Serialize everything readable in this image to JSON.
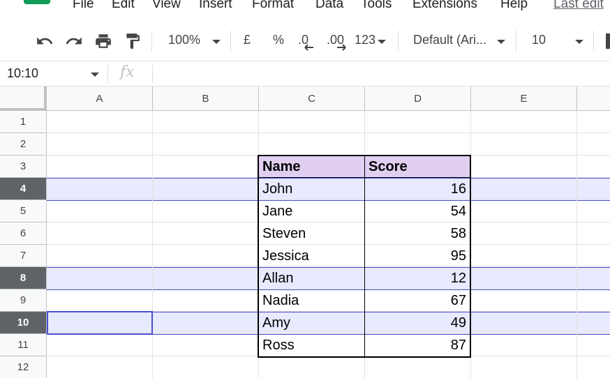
{
  "menu": {
    "items": [
      "File",
      "Edit",
      "View",
      "Insert",
      "Format",
      "Data",
      "Tools",
      "Extensions",
      "Help"
    ],
    "last_edit": "Last edit"
  },
  "toolbar": {
    "zoom": "100%",
    "currency": "£",
    "percent": "%",
    "decrease_decimal": ".0",
    "increase_decimal": ".00",
    "more_formats": "123",
    "font": "Default (Ari...",
    "font_size": "10"
  },
  "formula_bar": {
    "name_box": "10:10",
    "fx": "fx"
  },
  "grid": {
    "columns": [
      "A",
      "B",
      "C",
      "D",
      "E"
    ],
    "rows": [
      "1",
      "2",
      "3",
      "4",
      "5",
      "6",
      "7",
      "8",
      "9",
      "10",
      "11",
      "12"
    ],
    "selected_rows": [
      "4",
      "8",
      "10"
    ]
  },
  "table": {
    "headers": [
      "Name",
      "Score"
    ],
    "rows": [
      {
        "name": "John",
        "score": "16"
      },
      {
        "name": "Jane",
        "score": "54"
      },
      {
        "name": "Steven",
        "score": "58"
      },
      {
        "name": "Jessica",
        "score": "95"
      },
      {
        "name": "Allan",
        "score": "12"
      },
      {
        "name": "Nadia",
        "score": "67"
      },
      {
        "name": "Amy",
        "score": "49"
      },
      {
        "name": "Ross",
        "score": "87"
      }
    ]
  },
  "colors": {
    "header_fill": "#e0cff0",
    "row_highlight": "#e8eaff",
    "selection_border": "#4a4fd0",
    "selected_row_header": "#5f6368"
  }
}
